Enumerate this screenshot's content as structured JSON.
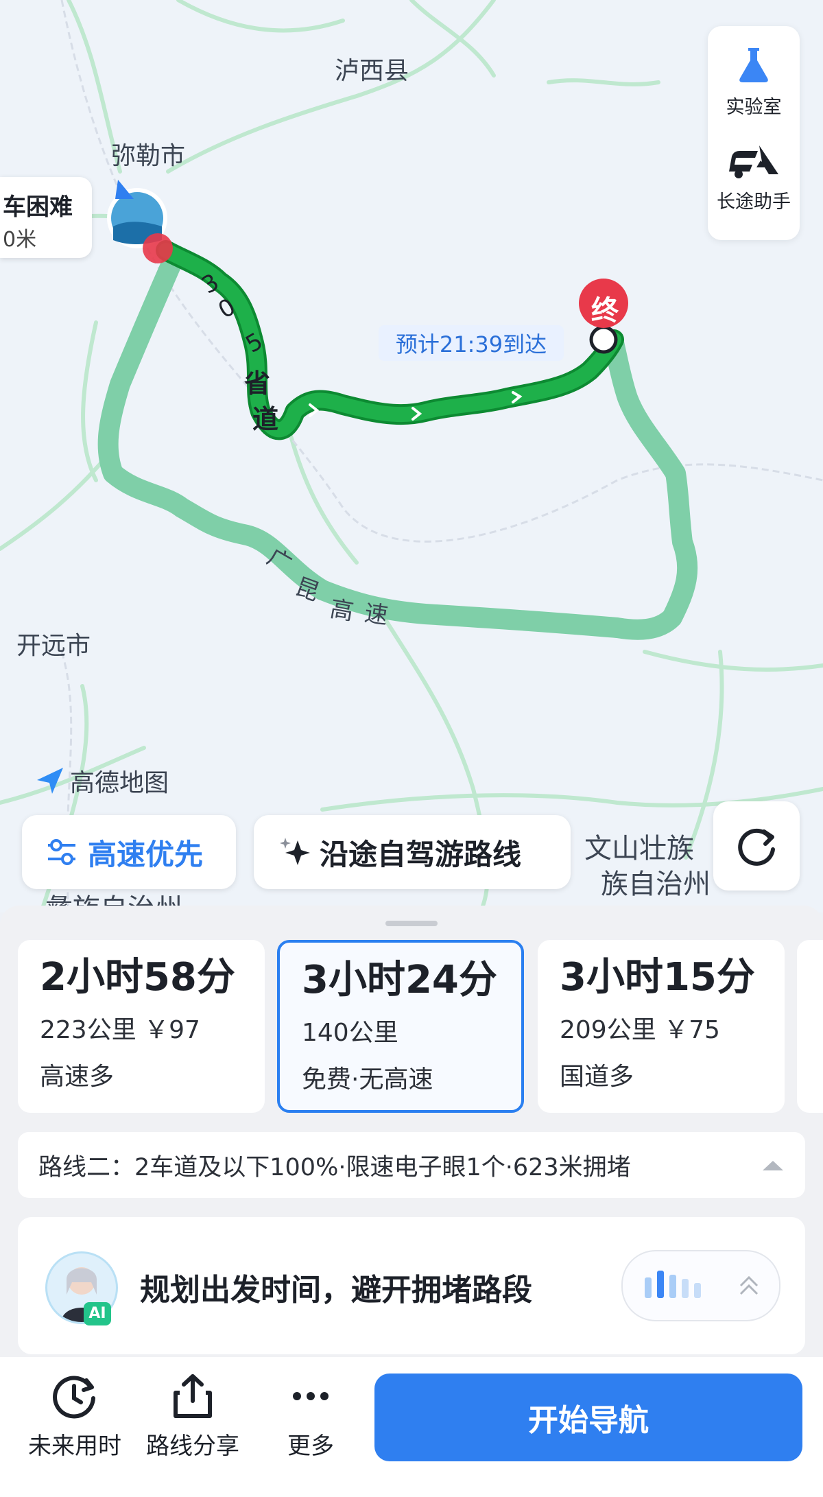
{
  "map": {
    "labels": {
      "luxi": "泸西县",
      "mile": "弥勒市",
      "kaiyuan": "开远市",
      "wenshan": "文山壮族",
      "wenshan2": "族自治州",
      "honghe": "彝族自治州"
    },
    "road_labels": {
      "provincial": [
        "3",
        "0",
        "5",
        "省",
        "道"
      ],
      "expressway": [
        "广",
        "昆",
        "高",
        "速"
      ]
    },
    "traffic_popup": {
      "title": "车困难",
      "sub": "0米"
    },
    "eta": "预计21:39到达",
    "end_marker": "终",
    "brand": "高德地图",
    "side_panel": {
      "lab": "实验室",
      "assistant": "长途助手"
    },
    "pref_button": "高速优先",
    "tour_button": "沿途自驾游路线",
    "colors": {
      "selected_route": "#1eb04a",
      "alt_route": "#7fcfa8",
      "accent": "#2f7ff0",
      "end_marker": "#e8394a"
    }
  },
  "routes": [
    {
      "time": "2小时58分",
      "distance": "223公里 ￥97",
      "tag": "高速多",
      "selected": false
    },
    {
      "time": "3小时24分",
      "distance": "140公里",
      "tag": "免费·无高速",
      "selected": true
    },
    {
      "time": "3小时15分",
      "distance": "209公里 ￥75",
      "tag": "国道多",
      "selected": false
    }
  ],
  "route_info": "路线二：2车道及以下100%·限速电子眼1个·623米拥堵",
  "ai": {
    "badge": "AI",
    "text": "规划出发时间，避开拥堵路段"
  },
  "footer": {
    "future": "未来用时",
    "share": "路线分享",
    "more": "更多",
    "start": "开始导航"
  }
}
